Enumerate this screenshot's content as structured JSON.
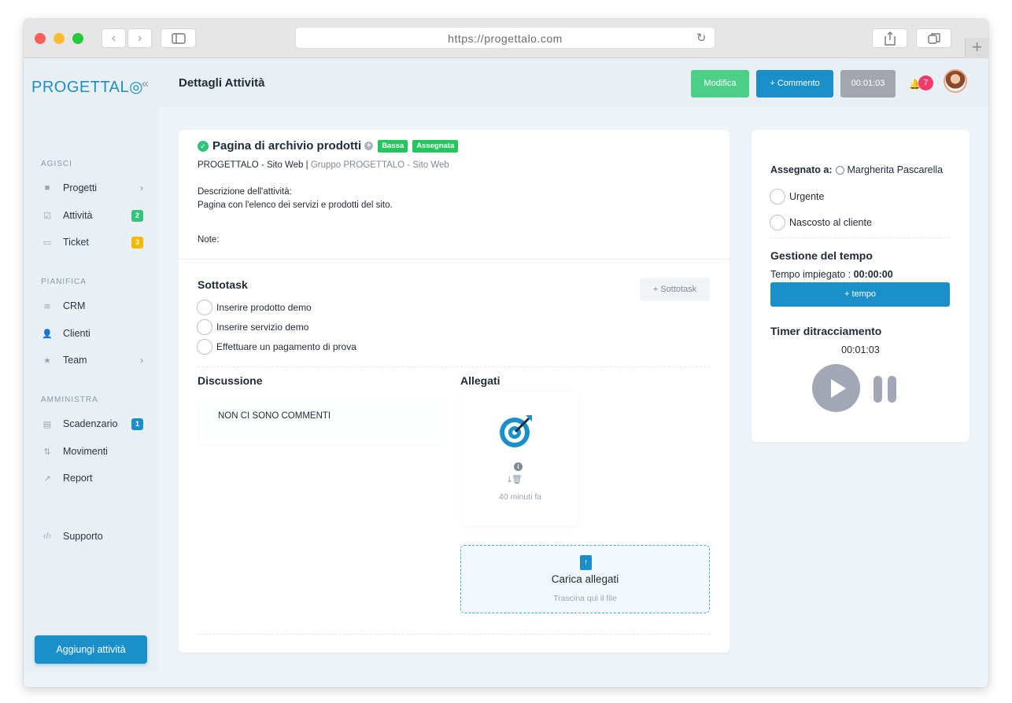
{
  "browser": {
    "url": "https://progettalo.com",
    "back": "‹",
    "forward": "›",
    "reload": "↻",
    "new_tab": "+"
  },
  "sidebar": {
    "logo": "PROGETTAL◎",
    "collapse": "«",
    "sections": {
      "agisci": "AGISCI",
      "pianifica": "PIANIFICA",
      "amministra": "AMMINISTRA"
    },
    "items": {
      "progetti": "Progetti",
      "attivita": "Attività",
      "attivita_badge": "2",
      "ticket": "Ticket",
      "ticket_badge": "3",
      "crm": "CRM",
      "clienti": "Clienti",
      "team": "Team",
      "scadenzario": "Scadenzario",
      "scadenzario_badge": "1",
      "movimenti": "Movimenti",
      "report": "Report",
      "supporto": "Supporto"
    },
    "add_button": "Aggiungi attività"
  },
  "header": {
    "title": "Dettagli Attività",
    "edit_button": "Modifica",
    "comment_button": "+ Commento",
    "timer_button": "00:01:03",
    "notifications": "7"
  },
  "task": {
    "title": "Pagina di archivio prodotti",
    "priority_tag": "Bassa",
    "status_tag": "Assegnata",
    "project": "PROGETTALO - Sito Web",
    "separator": "|",
    "group": "Gruppo PROGETTALO - Sito Web",
    "description_label": "Descrizione dell'attività:",
    "description": "Pagina con l'elenco dei servizi e prodotti del sito.",
    "notes_label": "Note:"
  },
  "subtasks": {
    "title": "Sottotask",
    "add_button": "+ Sottotask",
    "items": [
      "Inserire prodotto demo",
      "Inserire servizio demo",
      "Effettuare un pagamento di prova"
    ]
  },
  "discussion": {
    "title": "Discussione",
    "empty": "NON CI SONO COMMENTI"
  },
  "attachments": {
    "title": "Allegati",
    "info": "i",
    "time": "40 minuti fa",
    "upload_title": "Carica allegati",
    "upload_subtitle": "Trascina qui il file"
  },
  "side": {
    "assigned_label": "Assegnato a:",
    "assigned_user": "Margherita Pascarella",
    "option_urgent": "Urgente",
    "option_hidden": "Nascosto al cliente",
    "time_title": "Gestione del tempo",
    "time_spent_label": "Tempo impiegato :",
    "time_spent_value": "00:00:00",
    "add_time_button": "+ tempo",
    "timer_title": "Timer ditracciamento",
    "timer_value": "00:01:03"
  },
  "colors": {
    "primary": "#1a8fc9",
    "success": "#34c37b",
    "tag_green": "#22c55e",
    "badge_yellow": "#f5b700",
    "notif": "#f23a6b"
  }
}
